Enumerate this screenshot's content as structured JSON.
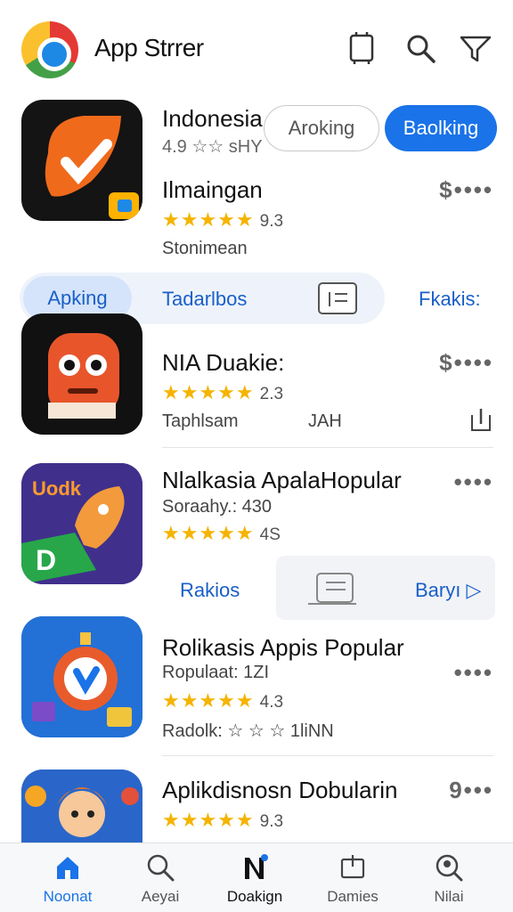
{
  "header": {
    "title": "App Strrer",
    "icons": [
      "bookmark-icon",
      "search-icon",
      "filter-icon"
    ]
  },
  "apps": [
    {
      "region": "Indonesia",
      "meta": "4.9 ☆☆ sHY",
      "name": "Ilmaingan",
      "rating": "9.3",
      "stars": "★★★★★",
      "sub": "Stonimean",
      "button_secondary": "Aroking",
      "button_primary": "Baolking",
      "more": "$••••"
    },
    {
      "name": "NIA Duakie:",
      "stars": "★★★★★",
      "rating": "2.3",
      "sub": "Taphlsam",
      "sub_right": "JAH",
      "more": "$••••"
    },
    {
      "name": "Nlalkasia  ApalaHopular",
      "sub": "Soraahy.: 430",
      "stars": "★★★★★",
      "rating": "4S",
      "more": "••••",
      "action_left": "Rakios",
      "action_right": "Baryı ▷"
    },
    {
      "name": "Rolikasis Appis Popular",
      "sub": "Ropulaat: 1ZI",
      "stars": "★★★★★",
      "rating": "4.3",
      "sub2": "Radolk:  ☆ ☆ ☆  1liNN",
      "more": "••••"
    },
    {
      "name": "Aplikdisnosn Dobularin",
      "stars": "★★★★★",
      "rating": "9.3",
      "more": "9•••"
    }
  ],
  "filter": {
    "active": "Apking",
    "option2": "Tadarlbos",
    "option3": "Fkakis:"
  },
  "bottom_nav": [
    {
      "label": "Noonat",
      "icon": "home-icon"
    },
    {
      "label": "Aeyai",
      "icon": "search-icon"
    },
    {
      "label": "Doakign",
      "icon": "news-icon"
    },
    {
      "label": "Damies",
      "icon": "tv-icon"
    },
    {
      "label": "Nilai",
      "icon": "profile-search-icon"
    }
  ],
  "colors": {
    "accent": "#1a73e8",
    "star": "#f4b400"
  }
}
